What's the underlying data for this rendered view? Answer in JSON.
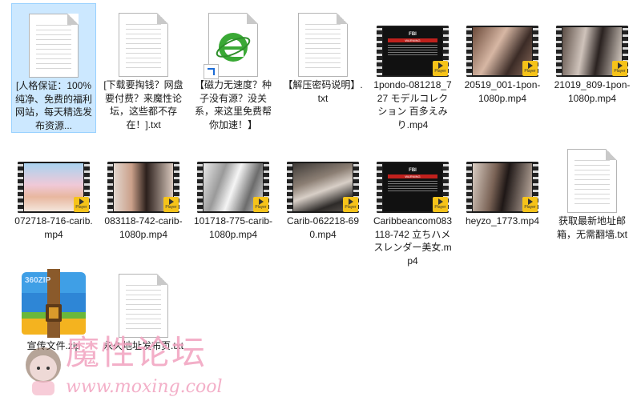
{
  "files": [
    {
      "name": "[人格保证：100%纯净、免费的福利网站，每天精选发布资源...",
      "kind": "txt",
      "selected": true
    },
    {
      "name": "[下载要掏钱？网盘要付费？来魔性论坛，这些都不存在！].txt",
      "kind": "txt"
    },
    {
      "name": "【磁力无速度？种子没有源？没关系，来这里免费帮你加速！】",
      "kind": "ie-shortcut"
    },
    {
      "name": "【解压密码说明】.txt",
      "kind": "txt"
    },
    {
      "name": "1pondo-081218_727 モデルコレクション 百多えみり.mp4",
      "kind": "video",
      "thumb": "fbi"
    },
    {
      "name": "20519_001-1pon-1080p.mp4",
      "kind": "video",
      "thumb": "photo"
    },
    {
      "name": "21019_809-1pon-1080p.mp4",
      "kind": "video",
      "thumb": "photo"
    },
    {
      "name": "072718-716-carib.mp4",
      "kind": "video",
      "thumb": "photo"
    },
    {
      "name": "083118-742-carib-1080p.mp4",
      "kind": "video",
      "thumb": "photo"
    },
    {
      "name": "101718-775-carib-1080p.mp4",
      "kind": "video",
      "thumb": "photo"
    },
    {
      "name": "Carib-062218-690.mp4",
      "kind": "video",
      "thumb": "photo"
    },
    {
      "name": "Caribbeancom083118-742 立ちハメスレンダー美女.mp4",
      "kind": "video",
      "thumb": "fbi"
    },
    {
      "name": "heyzo_1773.mp4",
      "kind": "video",
      "thumb": "photo"
    },
    {
      "name": "获取最新地址邮箱，无需翻墙.txt",
      "kind": "txt"
    },
    {
      "name": "宣传文件.zip",
      "kind": "zip"
    },
    {
      "name": "永久地址发布页.txt",
      "kind": "txt"
    }
  ],
  "thumb_text": {
    "fbi": "FBI",
    "warning": "WARNING",
    "player": "Player"
  },
  "zip_badge": "360ZIP",
  "watermark": {
    "title": "魔性论坛",
    "url": "www.moxing.cool"
  },
  "colors": {
    "selection": "#cce8ff",
    "selection_border": "#99d1ff",
    "player_badge": "#f6c319",
    "ie_green": "#3aa935",
    "watermark_pink": "#f2a7c3"
  }
}
